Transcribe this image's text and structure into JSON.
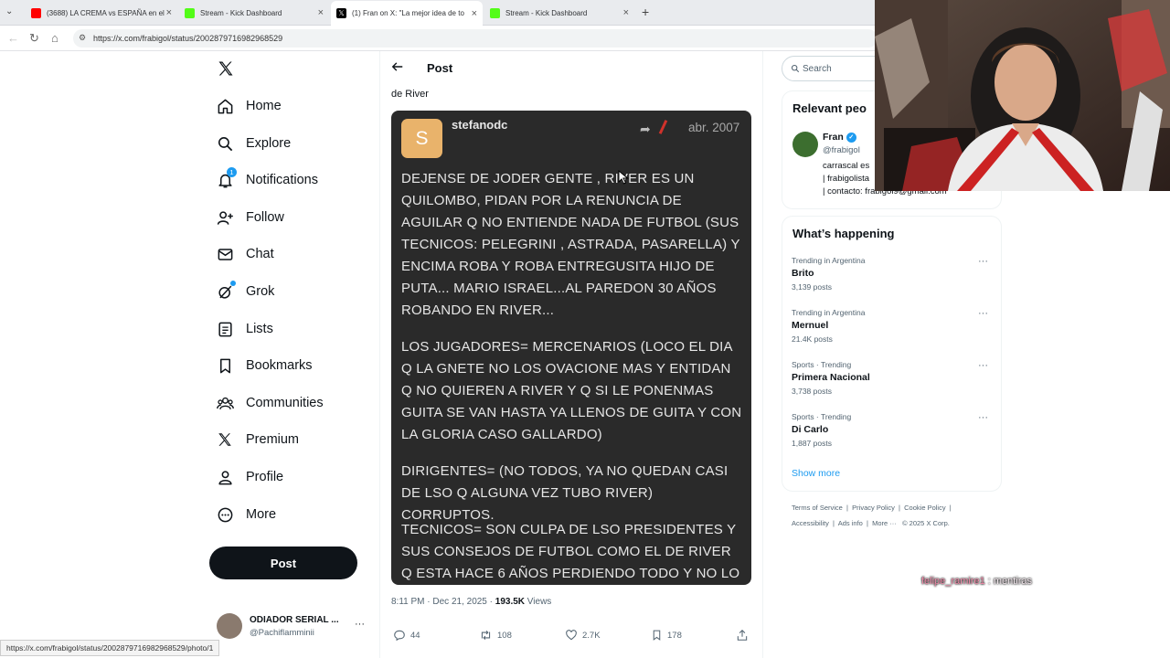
{
  "browser": {
    "tabs": [
      {
        "title": "(3688) LA CREMA vs ESPAÑA en el",
        "favicon_color": "#ff0000"
      },
      {
        "title": "Stream - Kick Dashboard",
        "favicon_color": "#53fc18"
      },
      {
        "title": "(1) Fran on X: \"La mejor idea de to",
        "favicon_color": "#000000"
      },
      {
        "title": "Stream - Kick Dashboard",
        "favicon_color": "#53fc18"
      }
    ],
    "new_tab_label": "+",
    "url": "https://x.com/frabigol/status/2002879716982968529"
  },
  "nav": {
    "items": [
      {
        "label": "Home",
        "icon": "home-icon"
      },
      {
        "label": "Explore",
        "icon": "search-icon"
      },
      {
        "label": "Notifications",
        "icon": "bell-icon",
        "badge": "1"
      },
      {
        "label": "Follow",
        "icon": "add-person-icon"
      },
      {
        "label": "Chat",
        "icon": "mail-icon"
      },
      {
        "label": "Grok",
        "icon": "grok-icon"
      },
      {
        "label": "Lists",
        "icon": "list-icon"
      },
      {
        "label": "Bookmarks",
        "icon": "bookmark-icon"
      },
      {
        "label": "Communities",
        "icon": "communities-icon"
      },
      {
        "label": "Premium",
        "icon": "x-icon"
      },
      {
        "label": "Profile",
        "icon": "person-icon"
      },
      {
        "label": "More",
        "icon": "more-circle-icon"
      }
    ],
    "post_button": "Post",
    "account": {
      "name": "ODIADOR SERIAL ...",
      "handle": "@Pachiflamminii"
    }
  },
  "post": {
    "header_title": "Post",
    "text_snippet": "de River",
    "image": {
      "avatar_letter": "S",
      "username": "stefanodc",
      "date": "abr. 2007",
      "paragraphs": [
        "DEJENSE DE JODER GENTE , RIVER ES UN QUILOMBO, PIDAN POR LA RENUNCIA DE AGUILAR Q NO ENTIENDE NADA DE FUTBOL (SUS TECNICOS: PELEGRINI , ASTRADA, PASARELLA) Y ENCIMA ROBA Y ROBA ENTREGUSITA HIJO DE PUTA... MARIO ISRAEL...AL PAREDON 30 AÑOS ROBANDO EN RIVER...",
        "LOS JUGADORES= MERCENARIOS (LOCO EL DIA Q LA GNETE NO LOS OVACIONE MAS Y ENTIDAN Q NO QUIEREN A RIVER Y Q SI LE PONENMAS GUITA SE VAN HASTA YA LLENOS DE GUITA Y CON LA GLORIA CASO GALLARDO)",
        "DIRIGENTES= (NO TODOS, YA NO QUEDAN CASI DE LSO Q ALGUNA VEZ TUBO RIVER) CORRUPTOS.",
        "TECNICOS= SON CULPA DE LSO PRESIDENTES Y SUS CONSEJOS DE FUTBOL COMO EL DE RIVER Q ESTA HACE 6 AÑOS PERDIENDO TODO Y NO LO"
      ]
    },
    "timestamp": "8:11 PM · Dec 21, 2025 · ",
    "views_count": "193.5K",
    "views_label": " Views",
    "actions": {
      "replies": "44",
      "reposts": "108",
      "likes": "2.7K",
      "bookmarks": "178"
    }
  },
  "right": {
    "search_placeholder": "Search",
    "relevant_title": "Relevant peo",
    "relevant_user": {
      "name": "Fran",
      "handle": "@frabigol",
      "bio_line1": "carrascal es",
      "bio_line2": "| frabigolista",
      "bio_line3": "| contacto: frabigol9@gmail.com"
    },
    "happening_title": "What’s happening",
    "trends": [
      {
        "meta": "Trending in Argentina",
        "name": "Brito",
        "count": "3,139 posts"
      },
      {
        "meta": "Trending in Argentina",
        "name": "Mernuel",
        "count": "21.4K posts"
      },
      {
        "meta": "Sports · Trending",
        "name": "Primera Nacional",
        "count": "3,738 posts"
      },
      {
        "meta": "Sports · Trending",
        "name": "Di Carlo",
        "count": "1,887 posts"
      }
    ],
    "show_more": "Show more",
    "footer": {
      "line1": [
        "Terms of Service",
        "Privacy Policy",
        "Cookie Policy"
      ],
      "line2": [
        "Accessibility",
        "Ads info",
        "More ···",
        "© 2025 X Corp."
      ]
    }
  },
  "status_bar_url": "https://x.com/frabigol/status/2002879716982968529/photo/1",
  "stream_chat": {
    "user": "felipe_ramire1",
    "sep": " : ",
    "message": "mentiras"
  },
  "colors": {
    "accent": "#1d9bf0",
    "dark": "#0f1419",
    "muted": "#536471",
    "avatar_yellow": "#e9b36b",
    "chat_name": "#f08aa8"
  }
}
